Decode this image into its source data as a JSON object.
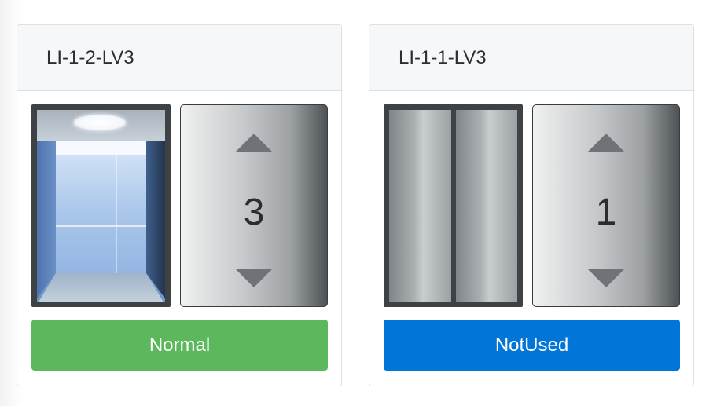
{
  "elevators": [
    {
      "name": "LI-1-2-LV3",
      "floor": "3",
      "door_state": "open",
      "status": "Normal",
      "status_color": "#5cb85c",
      "up_icon": "arrow-up-icon",
      "down_icon": "arrow-down-icon"
    },
    {
      "name": "LI-1-1-LV3",
      "floor": "1",
      "door_state": "closed",
      "status": "NotUsed",
      "status_color": "#0275d8",
      "up_icon": "arrow-up-icon",
      "down_icon": "arrow-down-icon"
    }
  ]
}
